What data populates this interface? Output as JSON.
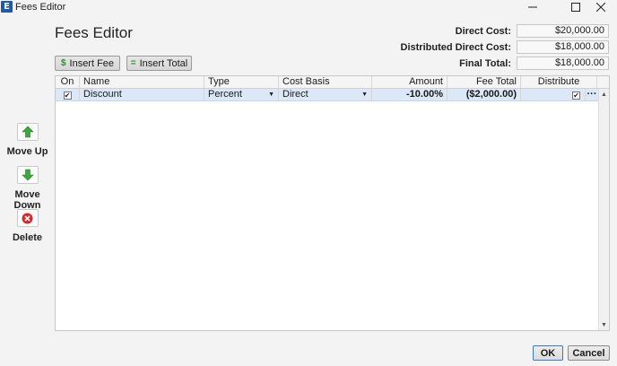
{
  "window": {
    "title": "Fees Editor",
    "app_icon": "E"
  },
  "heading": "Fees Editor",
  "totals": [
    {
      "label": "Direct Cost:",
      "value": "$20,000.00"
    },
    {
      "label": "Distributed Direct Cost:",
      "value": "$18,000.00"
    },
    {
      "label": "Final Total:",
      "value": "$18,000.00"
    }
  ],
  "toolbar": {
    "insert_fee": {
      "icon_glyph": "$",
      "label": "Insert Fee"
    },
    "insert_total": {
      "icon_glyph": "=",
      "label": "Insert Total"
    }
  },
  "side": {
    "move_up": "Move Up",
    "move_down": "Move Down",
    "delete": "Delete"
  },
  "grid": {
    "columns": [
      "On",
      "Name",
      "Type",
      "Cost Basis",
      "Amount",
      "Fee Total",
      "Distribute"
    ],
    "rows": [
      {
        "on": "✔",
        "name": "Discount",
        "type": "Percent",
        "cost_basis": "Direct",
        "amount": "-10.00%",
        "fee_total": "($2,000.00)",
        "distribute": "✔",
        "more": "···"
      }
    ]
  },
  "buttons": {
    "ok": "OK",
    "cancel": "Cancel"
  },
  "colors": {
    "selection_row": "#dce8f7",
    "accent": "#1f5aa6",
    "arrow_green": "#3aa83a",
    "delete_red": "#d42a2a"
  }
}
